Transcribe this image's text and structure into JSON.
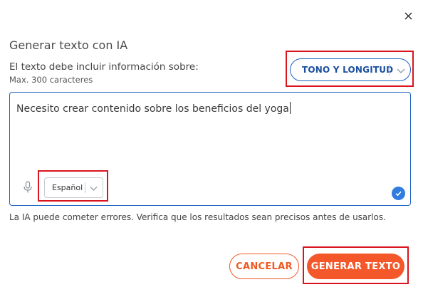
{
  "dialog": {
    "title": "Generar texto con IA",
    "prompt_label": "El texto debe incluir información sobre:",
    "max_chars": "Max. 300 caracteres",
    "tone_select": {
      "label": "TONO Y LONGITUD",
      "icon": "chevron-down-icon"
    },
    "text_input": {
      "value": "Necesito crear contenido sobre los beneficios del yoga"
    },
    "language_select": {
      "value": "Español",
      "icon": "chevron-down-icon"
    },
    "disclaimer": "La IA puede cometer errores. Verifica que los resultados sean precisos antes de usarlos.",
    "cancel_label": "CANCELAR",
    "generate_label": "GENERAR TEXTO"
  },
  "colors": {
    "accent_blue": "#1d62c4",
    "accent_orange": "#f4572a",
    "highlight_red": "#d9141e"
  }
}
